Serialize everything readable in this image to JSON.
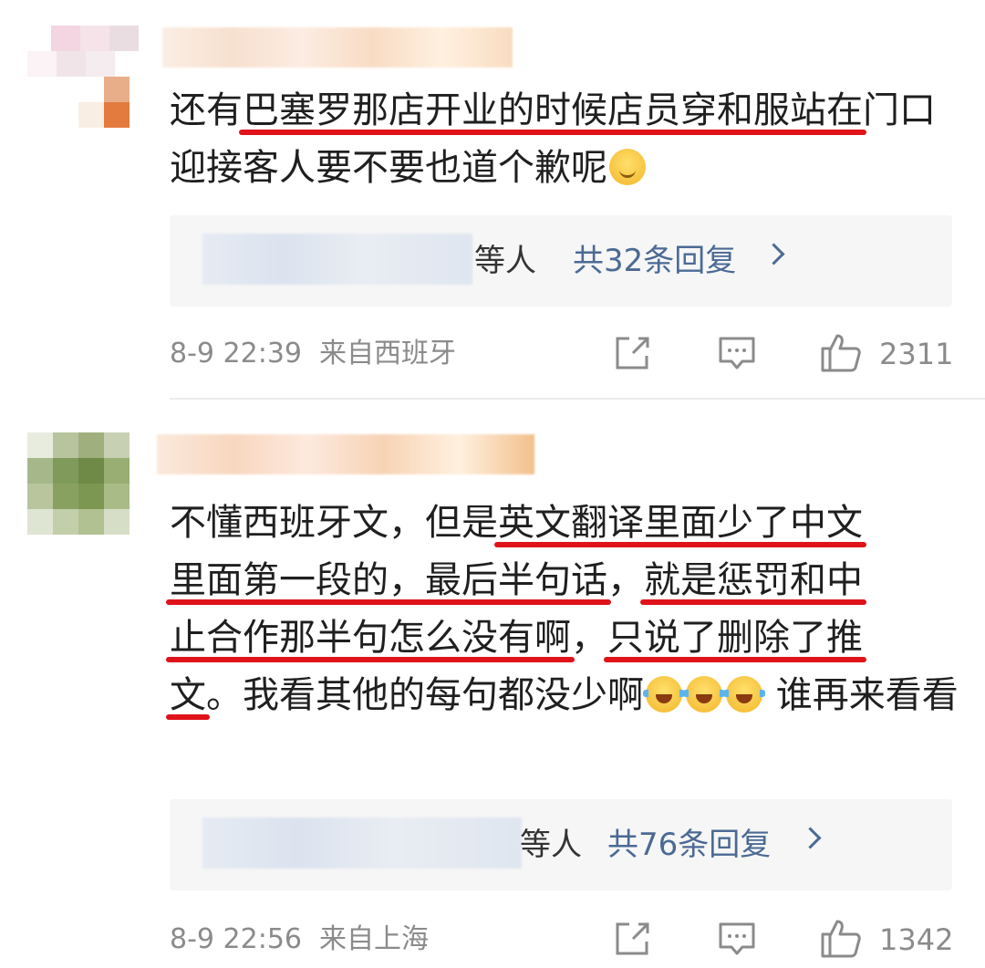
{
  "comments": [
    {
      "text_parts": [
        {
          "t": "还有",
          "hl": false
        },
        {
          "t": "巴塞罗那店开业的时候店员穿和服站在",
          "hl": true
        },
        {
          "t": "门口迎接客人要不要也道个歉呢",
          "hl": false
        }
      ],
      "emojis": [
        "smile"
      ],
      "replies": {
        "by_suffix": "等人",
        "count_label": "共32条回复"
      },
      "meta": {
        "time": "8-9 22:39",
        "location": "来自西班牙"
      },
      "likes": "2311"
    },
    {
      "text_parts": [
        {
          "t": "不懂西班牙文，但是",
          "hl": false
        },
        {
          "t": "英文翻译里面少了中文",
          "hl": true
        },
        {
          "t": "里面第一段的，最后半句话",
          "hl": true
        },
        {
          "t": "，",
          "hl": false
        },
        {
          "t": "就是惩罚和中",
          "hl": true
        },
        {
          "t": "止合作那半句怎么没有啊",
          "hl": true
        },
        {
          "t": "，",
          "hl": false
        },
        {
          "t": "只说了删除了推",
          "hl": true
        },
        {
          "t": "文",
          "hl": true
        },
        {
          "t": "。我看其他的每句都没少啊",
          "hl": false
        },
        {
          "t": " 谁再来看看",
          "hl": false
        }
      ],
      "emojis": [
        "laugh",
        "laugh",
        "laugh"
      ],
      "replies": {
        "by_suffix": "等人",
        "count_label": "共76条回复"
      },
      "meta": {
        "time": "8-9 22:56",
        "location": "来自上海"
      },
      "likes": "1342"
    }
  ],
  "icons": {
    "share": "share-icon",
    "comment": "comment-icon",
    "like": "thumbs-up-icon"
  },
  "colors": {
    "highlight": "#e0121a",
    "link": "#4b6a94",
    "meta": "#8b8b8b"
  }
}
